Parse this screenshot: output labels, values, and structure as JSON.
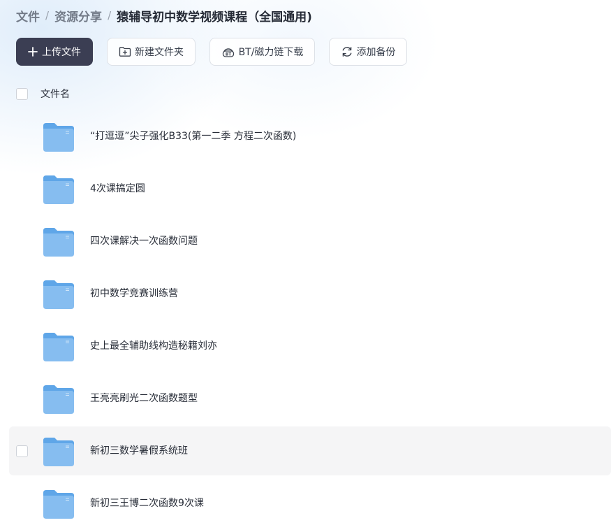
{
  "breadcrumb": {
    "root": "文件",
    "separator": "/",
    "parent": "资源分享",
    "current": "猿辅导初中数学视频课程（全国通用)"
  },
  "toolbar": {
    "upload_label": "上传文件",
    "new_folder_label": "新建文件夹",
    "bt_label": "BT/磁力链下载",
    "backup_label": "添加备份"
  },
  "list": {
    "header_label": "文件名",
    "files": [
      {
        "name": "“打逗逗”尖子强化B33(第一二季 方程二次函数)"
      },
      {
        "name": "4次课搞定圆"
      },
      {
        "name": "四次课解决一次函数问题"
      },
      {
        "name": "初中数学竞赛训练营"
      },
      {
        "name": "史上最全辅助线构造秘籍刘亦"
      },
      {
        "name": "王亮亮刷光二次函数题型"
      },
      {
        "name": "新初三数学暑假系统班"
      },
      {
        "name": "新初三王博二次函数9次课"
      }
    ]
  },
  "colors": {
    "primary_button": "#3b3e53",
    "folder_back": "#5fa6e8",
    "folder_front": "#86bdf0",
    "hover_row": "#f5f5f6"
  },
  "icons": {
    "upload": "plus-icon",
    "new_folder": "folder-plus-icon",
    "bt": "bt-icon",
    "backup": "sync-icon",
    "file": "folder-icon"
  }
}
